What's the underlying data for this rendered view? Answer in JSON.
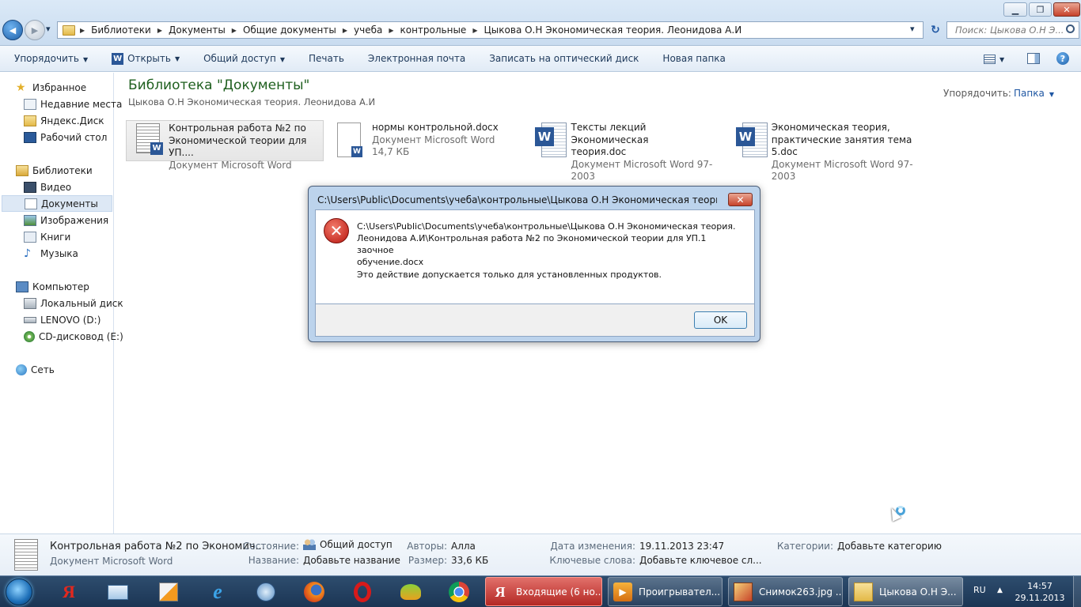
{
  "window": {
    "minimize_glyph": "▁",
    "maximize_glyph": "❐",
    "close_glyph": "✕"
  },
  "nav": {
    "back_glyph": "◀",
    "forward_glyph": "▶",
    "dropdown_glyph": "▾",
    "refresh_glyph": "↻"
  },
  "address": {
    "crumbs": [
      "Библиотеки",
      "Документы",
      "Общие документы",
      "учеба",
      "контрольные",
      "Цыкова О.Н  Экономическая теория. Леонидова А.И"
    ],
    "separator": "▶"
  },
  "search": {
    "placeholder": "Поиск: Цыкова О.Н  Э..."
  },
  "toolbar": {
    "organize": "Упорядочить",
    "open": "Открыть",
    "share": "Общий доступ",
    "print": "Печать",
    "email": "Электронная почта",
    "burn": "Записать на оптический диск",
    "new_folder": "Новая папка",
    "help_glyph": "?"
  },
  "sidebar": {
    "favorites": "Избранное",
    "fav_items": [
      "Недавние места",
      "Яндекс.Диск",
      "Рабочий стол"
    ],
    "libraries": "Библиотеки",
    "lib_items": [
      "Видео",
      "Документы",
      "Изображения",
      "Книги",
      "Музыка"
    ],
    "computer": "Компьютер",
    "comp_items": [
      "Локальный диск",
      "LENOVO (D:)",
      "CD-дисковод (E:)"
    ],
    "network": "Сеть"
  },
  "main": {
    "title": "Библиотека \"Документы\"",
    "subtitle": "Цыкова О.Н  Экономическая теория. Леонидова А.И",
    "sort_label": "Упорядочить:",
    "sort_value": "Папка",
    "files": [
      {
        "name1": "Контрольная работа №2 по",
        "name2": "Экономической теории для УП....",
        "meta": "Документ Microsoft Word"
      },
      {
        "name1": "нормы контрольной.docx",
        "name2": "Документ Microsoft Word",
        "meta": "14,7 КБ"
      },
      {
        "name1": "Тексты лекций  Экономическая",
        "name2": "теория.doc",
        "meta": "Документ Microsoft Word 97-2003"
      },
      {
        "name1": "Экономическая теория,",
        "name2": "практические занятия тема 5.doc",
        "meta": "Документ Microsoft Word 97-2003"
      }
    ]
  },
  "dialog": {
    "title": "C:\\Users\\Public\\Documents\\учеба\\контрольные\\Цыкова О.Н  Экономическая теория. Леон...",
    "close_glyph": "✕",
    "path_line1": "C:\\Users\\Public\\Documents\\учеба\\контрольные\\Цыкова О.Н  Экономическая теория.",
    "path_line2": "Леонидова А.И\\Контрольная работа №2 по Экономической теории для УП.1 заочное",
    "path_line3": "обучение.docx",
    "message": "Это действие допускается только для установленных продуктов.",
    "ok": "OK"
  },
  "details": {
    "file_name": "Контрольная работа №2 по Экономич...",
    "file_type": "Документ Microsoft Word",
    "state_label": "Состояние:",
    "state_value": "Общий доступ",
    "title_label": "Название:",
    "title_value": "Добавьте название",
    "authors_label": "Авторы:",
    "authors_value": "Алла",
    "size_label": "Размер:",
    "size_value": "33,6 КБ",
    "modified_label": "Дата изменения:",
    "modified_value": "19.11.2013 23:47",
    "keywords_label": "Ключевые слова:",
    "keywords_value": "Добавьте ключевое сл...",
    "categories_label": "Категории:",
    "categories_value": "Добавьте категорию"
  },
  "taskbar": {
    "tasks": [
      "Входящие (6 но...",
      "Проигрывател...",
      "Снимок263.jpg ...",
      "Цыкова О.Н  Э..."
    ],
    "lang": "RU",
    "time": "14:57",
    "date": "29.11.2013",
    "tray_up_glyph": "▲"
  },
  "colors": {
    "accent": "#1f57a3",
    "title_green": "#1e5f1e",
    "error_red": "#cc1f1f",
    "taskbar": "#1b3554"
  },
  "icons": [
    "back-icon",
    "forward-icon",
    "folder-icon",
    "word-icon",
    "error-icon",
    "star-icon",
    "library-icon",
    "computer-icon",
    "network-icon",
    "start-orb-icon"
  ]
}
